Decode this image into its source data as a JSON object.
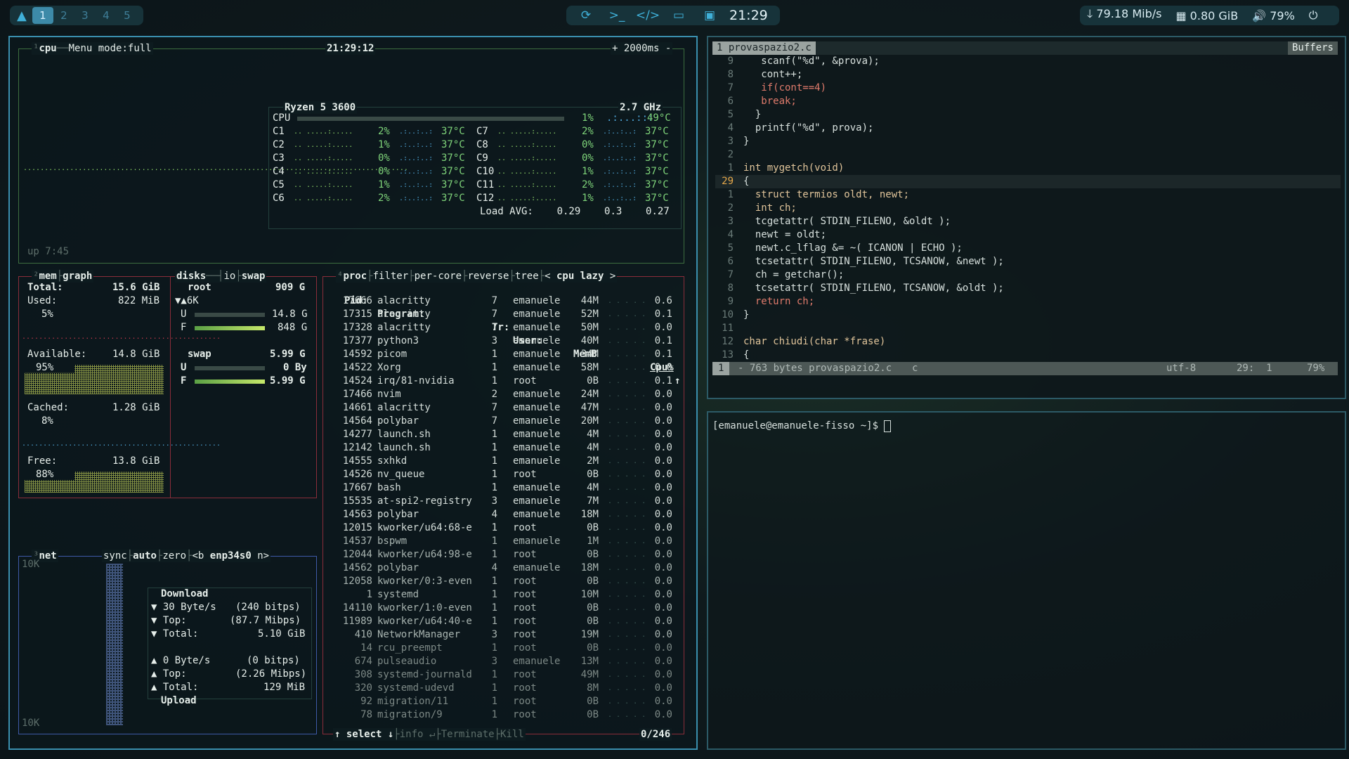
{
  "topbar": {
    "workspaces": [
      "1",
      "2",
      "3",
      "4",
      "5"
    ],
    "active_ws": "1",
    "clock": "21:29",
    "download": "79.18 Mib/s",
    "memory": "0.80 GiB",
    "volume": "79%",
    "icons": [
      "arch-logo-icon",
      "refresh-icon",
      "terminal-icon",
      "code-icon",
      "folder-icon",
      "monitor-icon",
      "download-arrow-icon",
      "ram-icon",
      "speaker-icon",
      "power-icon"
    ]
  },
  "cpu": {
    "label": "cpu",
    "menu": "Menu",
    "mode": "mode:full",
    "time": "21:29:12",
    "interval": "+ 2000ms -",
    "model": "Ryzen 5 3600",
    "freq": "2.7 GHz",
    "total_label": "CPU",
    "total_pct": "1%",
    "total_temp": "49°C",
    "cores_left": [
      {
        "name": "C1",
        "pct": "2%",
        "temp": "37°C"
      },
      {
        "name": "C2",
        "pct": "1%",
        "temp": "37°C"
      },
      {
        "name": "C3",
        "pct": "0%",
        "temp": "37°C"
      },
      {
        "name": "C4",
        "pct": "0%",
        "temp": "37°C"
      },
      {
        "name": "C5",
        "pct": "1%",
        "temp": "37°C"
      },
      {
        "name": "C6",
        "pct": "2%",
        "temp": "37°C"
      }
    ],
    "cores_right": [
      {
        "name": "C7",
        "pct": "2%",
        "temp": "37°C"
      },
      {
        "name": "C8",
        "pct": "0%",
        "temp": "37°C"
      },
      {
        "name": "C9",
        "pct": "0%",
        "temp": "37°C"
      },
      {
        "name": "C10",
        "pct": "1%",
        "temp": "37°C"
      },
      {
        "name": "C11",
        "pct": "2%",
        "temp": "37°C"
      },
      {
        "name": "C12",
        "pct": "1%",
        "temp": "37°C"
      }
    ],
    "load_label": "Load AVG:",
    "load": [
      "0.29",
      "0.3",
      "0.27"
    ],
    "uptime": "up 7:45"
  },
  "mem": {
    "tabs": [
      "mem",
      "graph"
    ],
    "total_label": "Total:",
    "total": "15.6 GiB",
    "used_label": "Used:",
    "used": "822 MiB",
    "used_pct": "5%",
    "avail_label": "Available:",
    "avail": "14.8 GiB",
    "avail_pct": "95%",
    "cached_label": "Cached:",
    "cached": "1.28 GiB",
    "cached_pct": "8%",
    "free_label": "Free:",
    "free": "13.8 GiB",
    "free_pct": "88%"
  },
  "disks": {
    "tabs": [
      "disks",
      "io",
      "swap"
    ],
    "root_label": "root",
    "root_size": "909 G",
    "root_io": "▼▲6K",
    "root_u": "14.8 G",
    "root_f": "848 G",
    "swap_label": "swap",
    "swap_size": "5.99 G",
    "swap_u": "0 By",
    "swap_f": "5.99 G",
    "u_label": "U",
    "f_label": "F"
  },
  "net": {
    "label": "net",
    "sync": "sync",
    "auto": "auto",
    "zero": "zero",
    "prev": "<b",
    "iface": "enp34s0",
    "next": "n>",
    "scale_top": "10K",
    "scale_bottom": "10K",
    "download_label": "Download",
    "dl_rate": "30 Byte/s",
    "dl_bits": "(240 bitps)",
    "dl_top_label": "Top:",
    "dl_top": "(87.7 Mibps)",
    "dl_total_label": "Total:",
    "dl_total": "5.10 GiB",
    "ul_rate": "0 Byte/s",
    "ul_bits": "(0 bitps)",
    "ul_top_label": "Top:",
    "ul_top": "(2.26 Mibps)",
    "ul_total_label": "Total:",
    "ul_total": "129 MiB",
    "upload_label": "Upload"
  },
  "proc": {
    "tabs": [
      "proc",
      "filter",
      "per-core",
      "reverse",
      "tree",
      "<",
      "cpu lazy",
      ">"
    ],
    "headers": {
      "pid": "Pid:",
      "program": "Program:",
      "tr": "Tr:",
      "user": "User:",
      "mem": "MemB",
      "cpu": "Cpu%"
    },
    "rows": [
      [
        "17666",
        "alacritty",
        "7",
        "emanuele",
        "44M",
        "0.6"
      ],
      [
        "17315",
        "alacritty",
        "7",
        "emanuele",
        "52M",
        "0.1"
      ],
      [
        "17328",
        "alacritty",
        "7",
        "emanuele",
        "50M",
        "0.0"
      ],
      [
        "17377",
        "python3",
        "3",
        "emanuele",
        "40M",
        "0.1"
      ],
      [
        "14592",
        "picom",
        "1",
        "emanuele",
        "34M",
        "0.1"
      ],
      [
        "14522",
        "Xorg",
        "1",
        "emanuele",
        "58M",
        "0.0"
      ],
      [
        "14524",
        "irq/81-nvidia",
        "1",
        "root",
        "0B",
        "0.1"
      ],
      [
        "17466",
        "nvim",
        "2",
        "emanuele",
        "24M",
        "0.0"
      ],
      [
        "14661",
        "alacritty",
        "7",
        "emanuele",
        "47M",
        "0.0"
      ],
      [
        "14564",
        "polybar",
        "7",
        "emanuele",
        "20M",
        "0.0"
      ],
      [
        "14277",
        "launch.sh",
        "1",
        "emanuele",
        "4M",
        "0.0"
      ],
      [
        "12142",
        "launch.sh",
        "1",
        "emanuele",
        "4M",
        "0.0"
      ],
      [
        "14555",
        "sxhkd",
        "1",
        "emanuele",
        "2M",
        "0.0"
      ],
      [
        "14526",
        "nv_queue",
        "1",
        "root",
        "0B",
        "0.0"
      ],
      [
        "17667",
        "bash",
        "1",
        "emanuele",
        "4M",
        "0.0"
      ],
      [
        "15535",
        "at-spi2-registry",
        "3",
        "emanuele",
        "7M",
        "0.0"
      ],
      [
        "14563",
        "polybar",
        "4",
        "emanuele",
        "18M",
        "0.0"
      ],
      [
        "12015",
        "kworker/u64:68-e",
        "1",
        "root",
        "0B",
        "0.0"
      ],
      [
        "14537",
        "bspwm",
        "1",
        "emanuele",
        "1M",
        "0.0"
      ],
      [
        "12044",
        "kworker/u64:98-e",
        "1",
        "root",
        "0B",
        "0.0"
      ],
      [
        "14562",
        "polybar",
        "4",
        "emanuele",
        "18M",
        "0.0"
      ],
      [
        "12058",
        "kworker/0:3-even",
        "1",
        "root",
        "0B",
        "0.0"
      ],
      [
        "1",
        "systemd",
        "1",
        "root",
        "10M",
        "0.0"
      ],
      [
        "14110",
        "kworker/1:0-even",
        "1",
        "root",
        "0B",
        "0.0"
      ],
      [
        "11989",
        "kworker/u64:40-e",
        "1",
        "root",
        "0B",
        "0.0"
      ],
      [
        "410",
        "NetworkManager",
        "3",
        "root",
        "19M",
        "0.0"
      ],
      [
        "14",
        "rcu_preempt",
        "1",
        "root",
        "0B",
        "0.0"
      ],
      [
        "674",
        "pulseaudio",
        "3",
        "emanuele",
        "13M",
        "0.0"
      ],
      [
        "308",
        "systemd-journald",
        "1",
        "root",
        "49M",
        "0.0"
      ],
      [
        "320",
        "systemd-udevd",
        "1",
        "root",
        "8M",
        "0.0"
      ],
      [
        "92",
        "migration/11",
        "1",
        "root",
        "0B",
        "0.0"
      ],
      [
        "78",
        "migration/9",
        "1",
        "root",
        "0B",
        "0.0"
      ]
    ],
    "footer_select": "↑ select ↓",
    "footer_info": "info ↵",
    "footer_terminate": "Terminate",
    "footer_kill": "Kill",
    "count": "0/246"
  },
  "editor": {
    "tab": "1 provaspazio2.c",
    "buffers": "Buffers",
    "lines": [
      {
        "n": "9",
        "text": "   scanf(\"%d\", &prova);"
      },
      {
        "n": "8",
        "text": "   cont++;"
      },
      {
        "n": "7",
        "text": "   if(cont==4)"
      },
      {
        "n": "6",
        "text": "   break;"
      },
      {
        "n": "5",
        "text": "  }"
      },
      {
        "n": "4",
        "text": "  printf(\"%d\", prova);"
      },
      {
        "n": "3",
        "text": "}"
      },
      {
        "n": "2",
        "text": ""
      },
      {
        "n": "1",
        "text": "int mygetch(void)"
      },
      {
        "n": "29",
        "text": "{"
      },
      {
        "n": "1",
        "text": "  struct termios oldt, newt;"
      },
      {
        "n": "2",
        "text": "  int ch;"
      },
      {
        "n": "3",
        "text": "  tcgetattr( STDIN_FILENO, &oldt );"
      },
      {
        "n": "4",
        "text": "  newt = oldt;"
      },
      {
        "n": "5",
        "text": "  newt.c_lflag &= ~( ICANON | ECHO );"
      },
      {
        "n": "6",
        "text": "  tcsetattr( STDIN_FILENO, TCSANOW, &newt );"
      },
      {
        "n": "7",
        "text": "  ch = getchar();"
      },
      {
        "n": "8",
        "text": "  tcsetattr( STDIN_FILENO, TCSANOW, &oldt );"
      },
      {
        "n": "9",
        "text": "  return ch;"
      },
      {
        "n": "10",
        "text": "}"
      },
      {
        "n": "11",
        "text": ""
      },
      {
        "n": "12",
        "text": "char chiudi(char *frase)"
      },
      {
        "n": "13",
        "text": "{"
      }
    ],
    "status_num": "1",
    "status_file": "- 763 bytes provaspazio2.c",
    "status_ft": "c",
    "status_enc": "utf-8",
    "status_pos": "29:  1",
    "status_pct": "79%"
  },
  "terminal": {
    "prompt": "[emanuele@emanuele-fisso ~]$ "
  }
}
